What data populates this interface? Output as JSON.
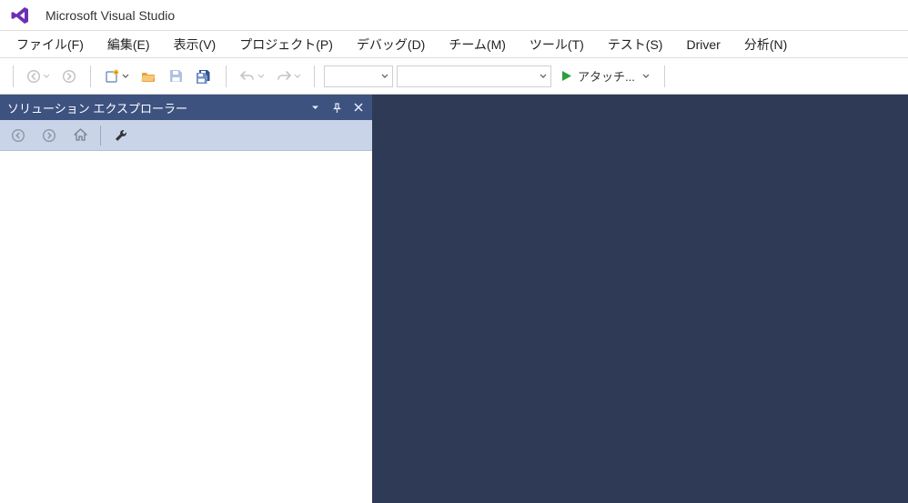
{
  "title": "Microsoft Visual Studio",
  "menu": {
    "file": "ファイル(F)",
    "edit": "編集(E)",
    "view": "表示(V)",
    "project": "プロジェクト(P)",
    "debug": "デバッグ(D)",
    "team": "チーム(M)",
    "tools": "ツール(T)",
    "test": "テスト(S)",
    "driver": "Driver",
    "analyze": "分析(N)"
  },
  "toolbar": {
    "attach_label": "アタッチ..."
  },
  "panel": {
    "title": "ソリューション エクスプローラー"
  }
}
